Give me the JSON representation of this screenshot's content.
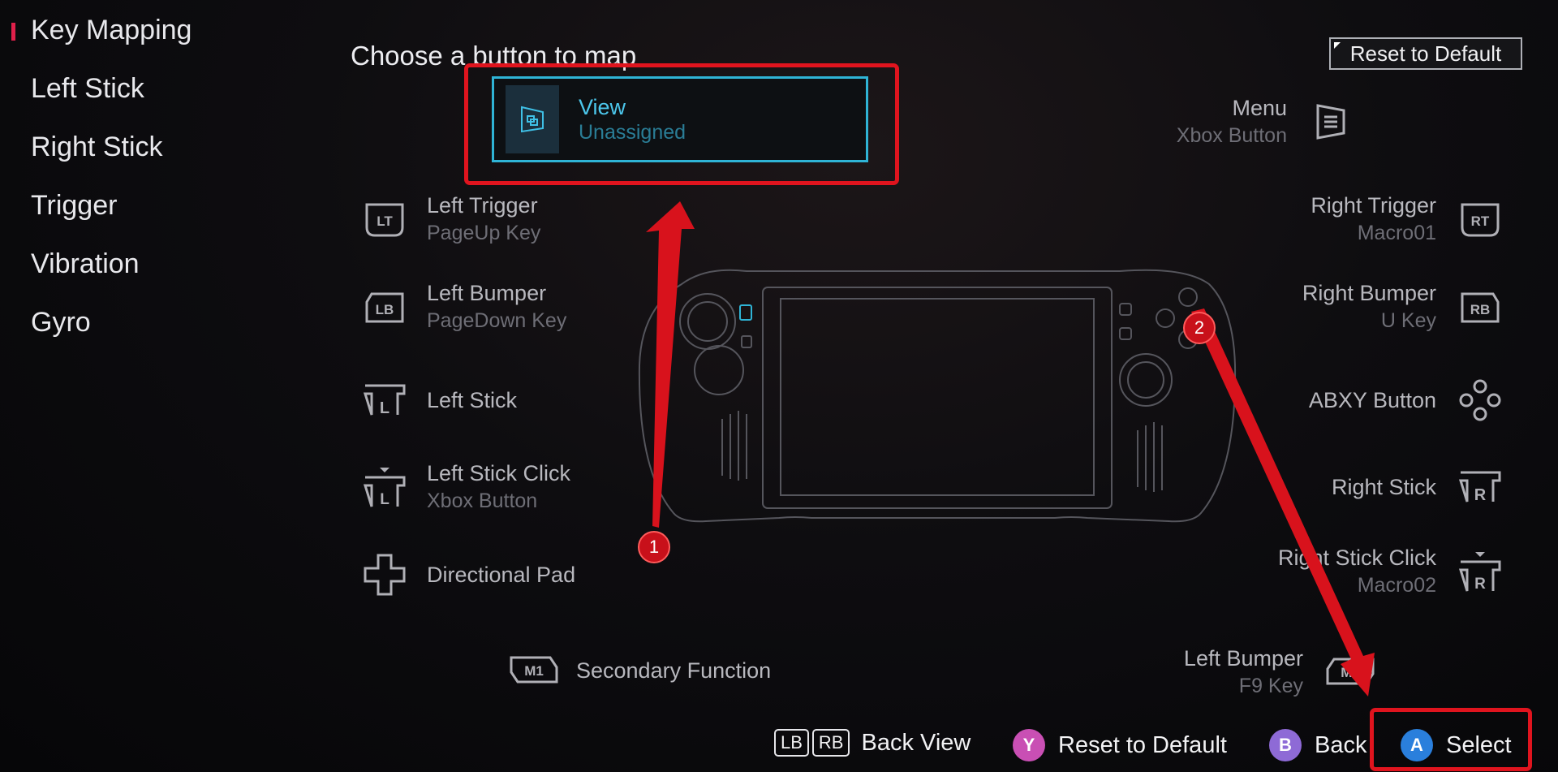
{
  "sidebar": {
    "items": [
      {
        "label": "Key Mapping",
        "active": true
      },
      {
        "label": "Left Stick"
      },
      {
        "label": "Right Stick"
      },
      {
        "label": "Trigger"
      },
      {
        "label": "Vibration"
      },
      {
        "label": "Gyro"
      }
    ]
  },
  "main": {
    "heading": "Choose a button to map",
    "reset_top": "Reset to Default",
    "selected": {
      "name": "View",
      "value": "Unassigned",
      "icon": "view-icon"
    },
    "left_buttons": [
      {
        "name": "Left Trigger",
        "value": "PageUp Key",
        "icon": "LT"
      },
      {
        "name": "Left Bumper",
        "value": "PageDown Key",
        "icon": "LB"
      },
      {
        "name": "Left Stick",
        "value": "",
        "icon": "L"
      },
      {
        "name": "Left Stick Click",
        "value": "Xbox Button",
        "icon": "L"
      },
      {
        "name": "Directional Pad",
        "value": "",
        "icon": "dpad-icon"
      },
      {
        "name": "Secondary Function",
        "value": "",
        "icon": "M1"
      }
    ],
    "right_buttons": [
      {
        "name": "Menu",
        "value": "Xbox Button",
        "icon": "menu-icon"
      },
      {
        "name": "Right Trigger",
        "value": "Macro01",
        "icon": "RT"
      },
      {
        "name": "Right Bumper",
        "value": "U Key",
        "icon": "RB"
      },
      {
        "name": "ABXY Button",
        "value": "",
        "icon": "abxy-icon"
      },
      {
        "name": "Right Stick",
        "value": "",
        "icon": "R"
      },
      {
        "name": "Right Stick Click",
        "value": "Macro02",
        "icon": "R"
      },
      {
        "name": "Left Bumper",
        "value": "F9 Key",
        "icon": "M2"
      }
    ]
  },
  "bottom": {
    "lb": "LB",
    "rb": "RB",
    "back_view": "Back View",
    "y": "Y",
    "reset": "Reset to Default",
    "b": "B",
    "back": "Back",
    "a": "A",
    "select": "Select"
  },
  "annotations": {
    "marker1": "1",
    "marker2": "2"
  },
  "colors": {
    "accent": "#2fb4d6",
    "annotation_red": "#e0141e",
    "y_button": "#c94fb4",
    "b_button": "#8e6ad6",
    "a_button": "#2a7fdc"
  }
}
